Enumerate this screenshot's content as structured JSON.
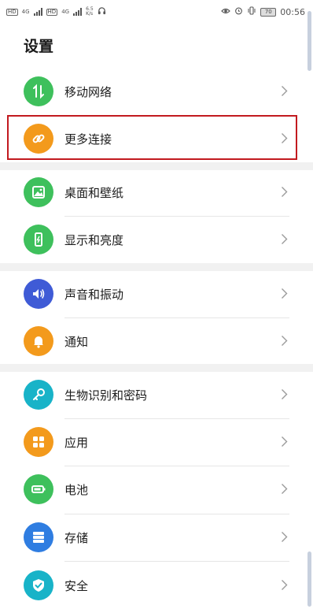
{
  "status_bar": {
    "sim1": "4G",
    "sim2": "4G",
    "net_speed_value": "6.5",
    "net_speed_unit": "K/s",
    "battery": "70",
    "time": "00:56"
  },
  "page": {
    "title": "设置"
  },
  "items": [
    {
      "label": "移动网络",
      "icon": "mobile-data-icon",
      "color": "#3ec05c"
    },
    {
      "label": "更多连接",
      "icon": "link-icon",
      "color": "#f39a1c"
    },
    {
      "label": "桌面和壁纸",
      "icon": "wallpaper-icon",
      "color": "#3ec05c"
    },
    {
      "label": "显示和亮度",
      "icon": "display-brightness-icon",
      "color": "#3ec05c"
    },
    {
      "label": "声音和振动",
      "icon": "volume-icon",
      "color": "#3f5bd6"
    },
    {
      "label": "通知",
      "icon": "bell-icon",
      "color": "#f39a1c"
    },
    {
      "label": "生物识别和密码",
      "icon": "key-icon",
      "color": "#18b3c8"
    },
    {
      "label": "应用",
      "icon": "apps-grid-icon",
      "color": "#f39a1c"
    },
    {
      "label": "电池",
      "icon": "battery-icon",
      "color": "#3ec05c"
    },
    {
      "label": "存储",
      "icon": "storage-icon",
      "color": "#2f7de1"
    },
    {
      "label": "安全",
      "icon": "shield-check-icon",
      "color": "#18b3c8"
    }
  ]
}
